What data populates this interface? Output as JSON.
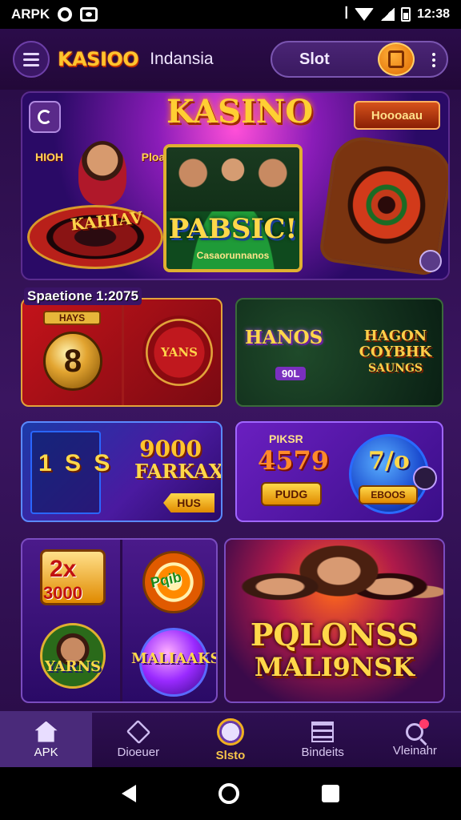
{
  "status_bar": {
    "carrier": "ARPK",
    "time": "12:38"
  },
  "header": {
    "logo": "KASIOO",
    "region": "Indansia",
    "pill_label": "Slot"
  },
  "banner": {
    "title": "KASINO",
    "tag": "Hoooaau",
    "left_label_a": "HIOH",
    "left_label_b": "Ploas",
    "roulette_label": "KAHIAV",
    "table_title": "PABSIC!",
    "table_sub": "Casaorunnanos"
  },
  "tiles": {
    "red": {
      "caption": "Spaetione 1:2075",
      "badge": "HAYS",
      "ball": "8",
      "chip": "YANS"
    },
    "green": {
      "left": "HANOS",
      "left_sub": "90L",
      "right_1": "HAGON",
      "right_2": "COYBHK",
      "right_3": "SAUNGS"
    },
    "blue": {
      "big": "1 S S",
      "num": "9000",
      "word": "FARKAX",
      "tag": "HUS"
    },
    "purple": {
      "top": "PIKSR",
      "mid": "4579",
      "btn": "PUDG",
      "pct": "7/o",
      "btn2": "EBOOS"
    },
    "mix": {
      "tl_a": "2x",
      "tl_b": "3000",
      "tr": "Pqib",
      "bl": "YARNS",
      "br": "MALIAAKS"
    },
    "promo": {
      "line1": "PQLONSS",
      "line2": "MALI9NSK"
    }
  },
  "bottom_nav": [
    {
      "label": "APK",
      "icon": "home-icon"
    },
    {
      "label": "Dioeuer",
      "icon": "box-icon"
    },
    {
      "label": "Slsto",
      "icon": "slot-icon"
    },
    {
      "label": "Bindeits",
      "icon": "grid-icon"
    },
    {
      "label": "Vleinahr",
      "icon": "search-icon"
    }
  ]
}
